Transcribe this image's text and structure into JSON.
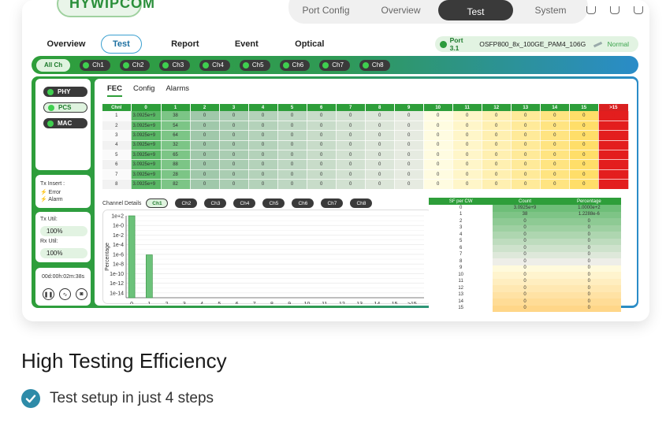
{
  "app": {
    "logo_text": "HYWIPCOM",
    "top_nav": [
      "Port Config",
      "Overview",
      "Test",
      "System"
    ],
    "top_nav_active": 2
  },
  "tabs": [
    {
      "label": "Overview",
      "active": false
    },
    {
      "label": "Test",
      "active": true
    },
    {
      "label": "Report",
      "active": false
    },
    {
      "label": "Event",
      "active": false
    },
    {
      "label": "Optical",
      "active": false
    }
  ],
  "port": {
    "name": "Port 3.1",
    "module": "OSFP800_8x_100GE_PAM4_106G",
    "status": "Normal"
  },
  "channels": {
    "all_label": "All Ch",
    "items": [
      "Ch1",
      "Ch2",
      "Ch3",
      "Ch4",
      "Ch5",
      "Ch6",
      "Ch7",
      "Ch8"
    ]
  },
  "layers": [
    {
      "label": "PHY",
      "selected": false
    },
    {
      "label": "PCS",
      "selected": true
    },
    {
      "label": "MAC",
      "selected": false
    }
  ],
  "tx_insert": {
    "label": "Tx Insert :",
    "items": [
      "Error",
      "Alarm"
    ]
  },
  "util": {
    "tx_label": "Tx Util:",
    "tx_value": "100%",
    "rx_label": "Rx Util:",
    "rx_value": "100%"
  },
  "timer": "00d:00h:02m:38s",
  "subtabs": [
    {
      "label": "FEC",
      "active": true
    },
    {
      "label": "Config",
      "active": false
    },
    {
      "label": "Alarms",
      "active": false
    }
  ],
  "fec_table": {
    "headers": [
      "Chnl",
      "0",
      "1",
      "2",
      "3",
      "4",
      "5",
      "6",
      "7",
      "8",
      "9",
      "10",
      "11",
      "12",
      "13",
      "14",
      "15",
      ">15"
    ],
    "rows": [
      [
        "1",
        "3.0925e+9",
        "38",
        "0",
        "0",
        "0",
        "0",
        "0",
        "0",
        "0",
        "0",
        "0",
        "0",
        "0",
        "0",
        "0",
        "0",
        "0"
      ],
      [
        "2",
        "3.0925e+9",
        "54",
        "0",
        "0",
        "0",
        "0",
        "0",
        "0",
        "0",
        "0",
        "0",
        "0",
        "0",
        "0",
        "0",
        "0",
        "0"
      ],
      [
        "3",
        "3.0925e+9",
        "64",
        "0",
        "0",
        "0",
        "0",
        "0",
        "0",
        "0",
        "0",
        "0",
        "0",
        "0",
        "0",
        "0",
        "0",
        "0"
      ],
      [
        "4",
        "3.0925e+9",
        "32",
        "0",
        "0",
        "0",
        "0",
        "0",
        "0",
        "0",
        "0",
        "0",
        "0",
        "0",
        "0",
        "0",
        "0",
        "0"
      ],
      [
        "5",
        "3.0925e+9",
        "65",
        "0",
        "0",
        "0",
        "0",
        "0",
        "0",
        "0",
        "0",
        "0",
        "0",
        "0",
        "0",
        "0",
        "0",
        "0"
      ],
      [
        "6",
        "3.0925e+9",
        "88",
        "0",
        "0",
        "0",
        "0",
        "0",
        "0",
        "0",
        "0",
        "0",
        "0",
        "0",
        "0",
        "0",
        "0",
        "0"
      ],
      [
        "7",
        "3.0925e+9",
        "28",
        "0",
        "0",
        "0",
        "0",
        "0",
        "0",
        "0",
        "0",
        "0",
        "0",
        "0",
        "0",
        "0",
        "0",
        "0"
      ],
      [
        "8",
        "3.0925e+9",
        "82",
        "0",
        "0",
        "0",
        "0",
        "0",
        "0",
        "0",
        "0",
        "0",
        "0",
        "0",
        "0",
        "0",
        "0",
        "0"
      ]
    ]
  },
  "channel_details": {
    "label": "Channel Details",
    "items": [
      "Ch1",
      "Ch2",
      "Ch3",
      "Ch4",
      "Ch5",
      "Ch6",
      "Ch7",
      "Ch8"
    ],
    "selected": 0
  },
  "chart_data": {
    "type": "bar",
    "ylabel": "Percentage",
    "y_ticks": [
      "1e+2",
      "1e-0",
      "1e-2",
      "1e-4",
      "1e-6",
      "1e-8",
      "1e-10",
      "1e-12",
      "1e-14"
    ],
    "y_log_range": [
      -15,
      2
    ],
    "categories": [
      "0",
      "1",
      "2",
      "3",
      "4",
      "5",
      "6",
      "7",
      "8",
      "9",
      "10",
      "11",
      "12",
      "13",
      "14",
      "15",
      ">15"
    ],
    "values_log10": [
      2.0,
      -6.1,
      null,
      null,
      null,
      null,
      null,
      null,
      null,
      null,
      null,
      null,
      null,
      null,
      null,
      null,
      null
    ]
  },
  "sf_table": {
    "headers": [
      "SF per CW",
      "Count",
      "Percentage"
    ],
    "rows": [
      [
        "0",
        "3.0925e+9",
        "1.0000e+2"
      ],
      [
        "1",
        "38",
        "1.2288e-6"
      ],
      [
        "2",
        "0",
        "0"
      ],
      [
        "3",
        "0",
        "0"
      ],
      [
        "4",
        "0",
        "0"
      ],
      [
        "5",
        "0",
        "0"
      ],
      [
        "6",
        "0",
        "0"
      ],
      [
        "7",
        "0",
        "0"
      ],
      [
        "8",
        "0",
        "0"
      ],
      [
        "9",
        "0",
        "0"
      ],
      [
        "10",
        "0",
        "0"
      ],
      [
        "11",
        "0",
        "0"
      ],
      [
        "12",
        "0",
        "0"
      ],
      [
        "13",
        "0",
        "0"
      ],
      [
        "14",
        "0",
        "0"
      ],
      [
        "15",
        "0",
        "0"
      ]
    ]
  },
  "marketing": {
    "headline": "High Testing Efficiency",
    "feature": "Test setup in just 4 steps"
  }
}
